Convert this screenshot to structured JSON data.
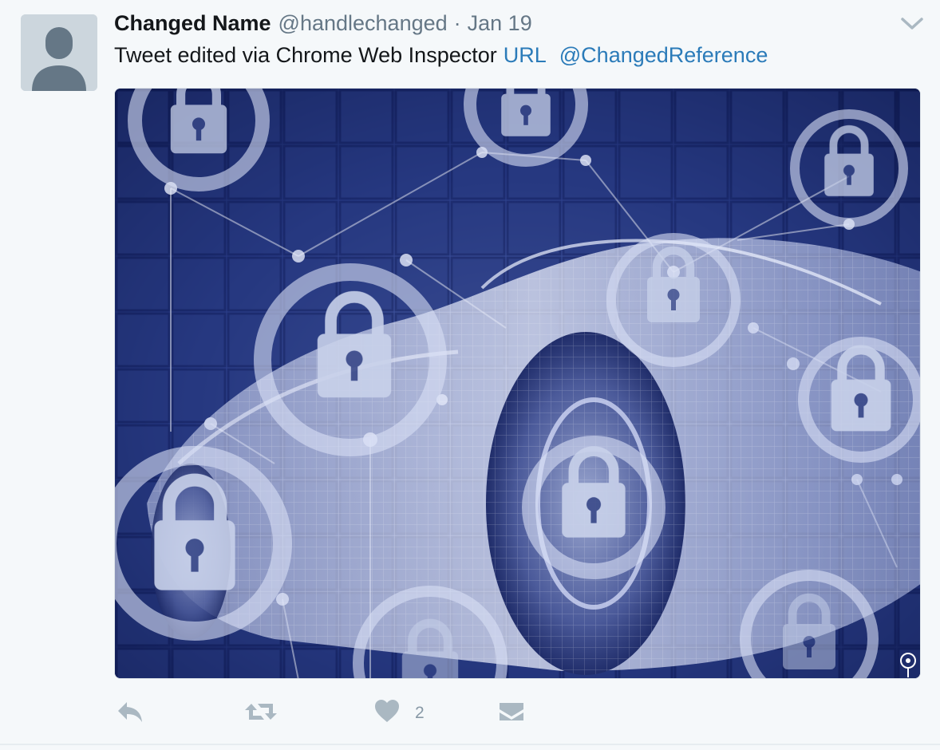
{
  "tweet": {
    "fullname": "Changed Name",
    "username": "@handlechanged",
    "separator": "·",
    "timestamp": "Jan 19",
    "text": "Tweet edited via Chrome Web Inspector",
    "url_link": "URL",
    "mention_link": "@ChangedReference",
    "media_icon": "lock-network-car-illustration"
  },
  "actions": {
    "reply_icon": "reply-icon",
    "retweet_icon": "retweet-icon",
    "like_icon": "heart-icon",
    "like_count": "2",
    "dm_icon": "envelope-icon"
  },
  "colors": {
    "link": "#2b7bb9",
    "secondary_text": "#657786",
    "action_icon": "#aab8c2",
    "background": "#f5f8fa"
  }
}
